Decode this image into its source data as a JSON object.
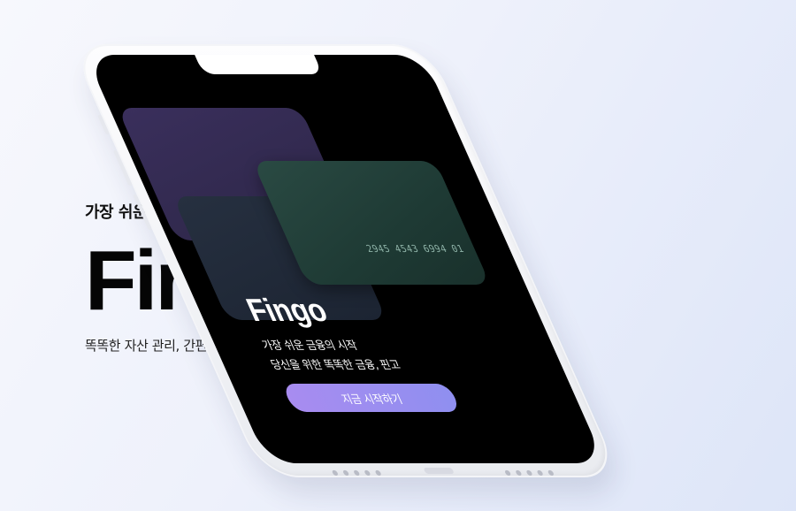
{
  "hero": {
    "eyebrow": "가장 쉬운 금융의 시작",
    "brand": "Fingo",
    "tagline": "똑똑한 자산 관리, 간편한 금융 생활"
  },
  "phone": {
    "card_number": "2945 4543 6994 01",
    "brand": "Fingo",
    "line1": "가장 쉬운 금융의 시작",
    "line2": "당신을 위한 똑똑한 금융, 핀고",
    "cta_label": "지금 시작하기"
  },
  "colors": {
    "accent_start": "#a88cf0",
    "accent_end": "#8f8ff0",
    "card_purple": "#3a2f5c",
    "card_green": "#2a4a43",
    "screen_bg": "#000000"
  }
}
